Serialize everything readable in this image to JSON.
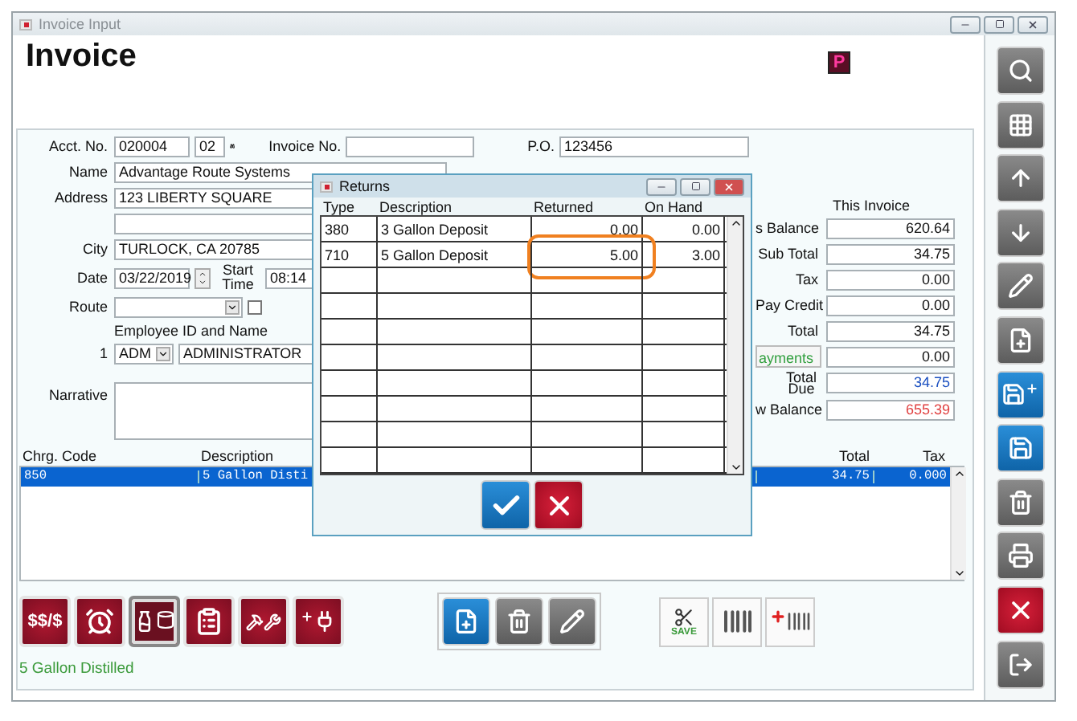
{
  "window": {
    "title": "Invoice Input"
  },
  "heading": "Invoice",
  "logo": "P",
  "account": {
    "acct_label": "Acct. No.",
    "acct_no": "020004",
    "branch": "02",
    "invoice_label": "Invoice No.",
    "po_label": "P.O.",
    "po": "123456"
  },
  "customer": {
    "name_label": "Name",
    "name": "Advantage Route Systems",
    "address_label": "Address",
    "address": "123 LIBERTY SQUARE",
    "city_label": "City",
    "city": "TURLOCK, CA  20785",
    "date_label": "Date",
    "date": "03/22/2019",
    "start_label": "Start Time",
    "start": "08:14",
    "route_label": "Route",
    "route_checked": false,
    "employee_heading": "Employee ID and Name",
    "employee_no": "1",
    "employee_id": "ADM",
    "employee_name": "ADMINISTRATOR",
    "narrative_label": "Narrative"
  },
  "summary": {
    "heading": "This Invoice",
    "rows": [
      {
        "label": "s Balance",
        "value": "620.64",
        "kind": "plain"
      },
      {
        "label": "Sub Total",
        "value": "34.75",
        "kind": "plain"
      },
      {
        "label": "Tax",
        "value": "0.00",
        "kind": "plain"
      },
      {
        "label": "Pay Credit",
        "value": "0.00",
        "kind": "plain"
      },
      {
        "label": "Total",
        "value": "34.75",
        "kind": "plain"
      },
      {
        "label": "ayments",
        "value": "0.00",
        "kind": "button"
      },
      {
        "label": "Total Due",
        "value": "34.75",
        "kind": "due"
      },
      {
        "label": "w Balance",
        "value": "655.39",
        "kind": "balance"
      }
    ]
  },
  "charges": {
    "columns": [
      "Chrg. Code",
      "Description",
      "Total",
      "Tax"
    ],
    "rows": [
      {
        "code": "850",
        "description": "5 Gallon Disti",
        "total": "34.75",
        "tax": "0.000",
        "selected": true
      }
    ]
  },
  "tool_buttons": [
    {
      "kind": "price",
      "label": "$$/$",
      "selected": false
    },
    {
      "kind": "alarm",
      "selected": false
    },
    {
      "kind": "bottles",
      "selected": true
    },
    {
      "kind": "cash",
      "selected": false
    },
    {
      "kind": "tools",
      "selected": false
    },
    {
      "kind": "plug",
      "selected": false
    }
  ],
  "edit_buttons": [
    {
      "kind": "add"
    },
    {
      "kind": "delete"
    },
    {
      "kind": "edit"
    }
  ],
  "scan_buttons": [
    {
      "kind": "save",
      "label": "SAVE"
    },
    {
      "kind": "scan"
    },
    {
      "kind": "scan-add"
    }
  ],
  "status": "5 Gallon Distilled",
  "side_toolbar": [
    {
      "kind": "search"
    },
    {
      "kind": "grid"
    },
    {
      "kind": "up"
    },
    {
      "kind": "down"
    },
    {
      "kind": "edit"
    },
    {
      "kind": "add"
    },
    {
      "kind": "save-new"
    },
    {
      "kind": "save"
    },
    {
      "kind": "delete"
    },
    {
      "kind": "print"
    },
    {
      "kind": "cancel"
    },
    {
      "kind": "exit"
    }
  ],
  "returns": {
    "title": "Returns",
    "columns": [
      "Type",
      "Description",
      "Returned",
      "On Hand"
    ],
    "rows": [
      {
        "type": "380",
        "description": "3 Gallon Deposit",
        "returned": "0.00",
        "on_hand": "0.00",
        "highlighted": false
      },
      {
        "type": "710",
        "description": "5 Gallon Deposit",
        "returned": "5.00",
        "on_hand": "3.00",
        "highlighted": true
      }
    ]
  }
}
